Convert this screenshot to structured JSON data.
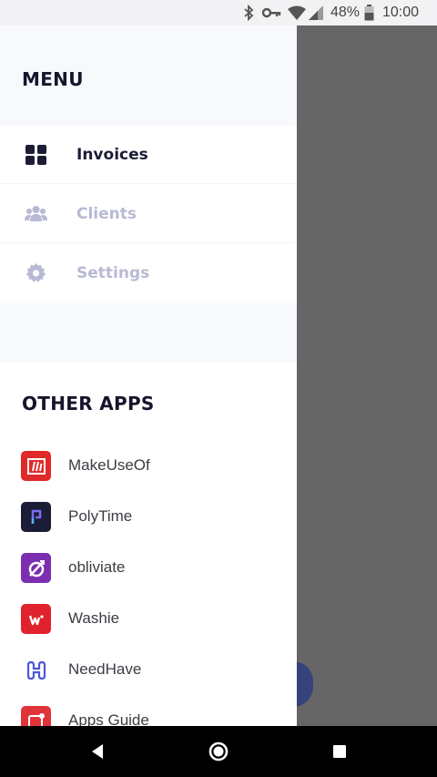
{
  "status_bar": {
    "battery_percent": "48%",
    "time": "10:00",
    "icons": [
      "bluetooth-icon",
      "vpn-key-icon",
      "wifi-icon",
      "cell-signal-icon",
      "battery-icon"
    ]
  },
  "drawer": {
    "menu_title": "MENU",
    "menu_items": [
      {
        "label": "Invoices",
        "icon": "grid-icon",
        "active": true
      },
      {
        "label": "Clients",
        "icon": "people-icon",
        "active": false
      },
      {
        "label": "Settings",
        "icon": "gear-icon",
        "active": false
      }
    ],
    "other_apps_title": "OTHER APPS",
    "apps": [
      {
        "label": "MakeUseOf",
        "icon": "makeuseof-icon",
        "color": "#e02a2a"
      },
      {
        "label": "PolyTime",
        "icon": "polytime-icon",
        "color": "#1a1d35"
      },
      {
        "label": "obliviate",
        "icon": "obliviate-icon",
        "color": "#7b2fb0"
      },
      {
        "label": "Washie",
        "icon": "washie-icon",
        "color": "#e0222e"
      },
      {
        "label": "NeedHave",
        "icon": "needhave-icon",
        "color": "#4b55e0"
      },
      {
        "label": "Apps Guide",
        "icon": "apps-guide-icon",
        "color": "#e0343a"
      }
    ]
  },
  "colors": {
    "accent_dark": "#15152b",
    "inactive": "#b8b9d3",
    "header_bg": "#f8f9fd",
    "scrim": "#666666"
  },
  "nav_bar": {
    "buttons": [
      "back-icon",
      "home-icon",
      "recents-icon"
    ]
  }
}
